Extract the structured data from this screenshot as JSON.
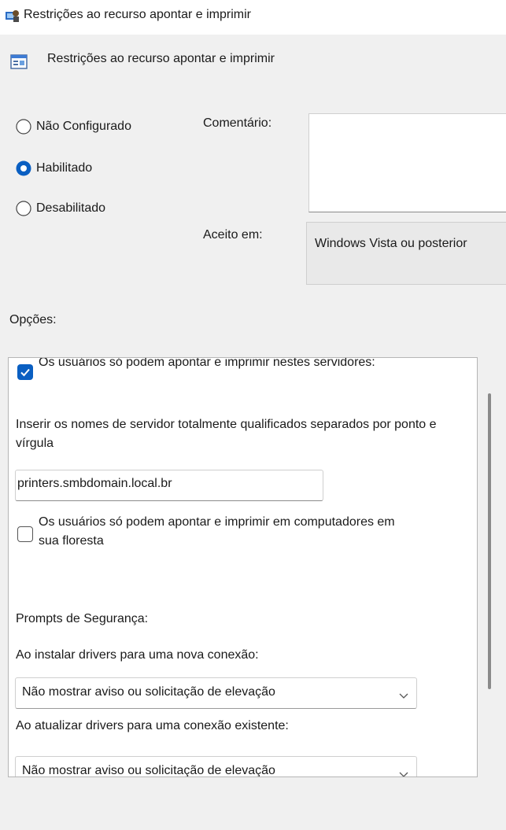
{
  "window": {
    "title": "Restrições ao recurso apontar e imprimir",
    "title_icon": "policy-window-icon"
  },
  "header": {
    "title": "Restrições ao recurso apontar e imprimir",
    "icon": "policy-setting-icon"
  },
  "state": {
    "options": [
      {
        "label": "Não Configurado",
        "selected": false
      },
      {
        "label": "Habilitado",
        "selected": true
      },
      {
        "label": "Desabilitado",
        "selected": false
      }
    ]
  },
  "comment": {
    "label": "Comentário:",
    "value": ""
  },
  "supported": {
    "label": "Aceito em:",
    "value": "Windows Vista ou posterior"
  },
  "options_section": {
    "label": "Opções:",
    "restrict_servers": {
      "label": "Os usuários só podem apontar e imprimir nestes servidores:",
      "checked": true
    },
    "servers_hint": "Inserir os nomes de servidor totalmente qualificados separados por ponto e vírgula",
    "servers_value": "printers.smbdomain.local.br",
    "restrict_forest": {
      "label": "Os usuários só podem apontar e imprimir em computadores em sua floresta",
      "checked": false
    },
    "security_prompts_label": "Prompts de Segurança:",
    "new_connection_label": "Ao instalar drivers para uma nova conexão:",
    "new_connection_value": "Não mostrar aviso ou solicitação de elevação",
    "existing_connection_label": "Ao atualizar drivers para uma conexão existente:",
    "existing_connection_value": "Não mostrar aviso ou solicitação de elevação"
  },
  "colors": {
    "accent": "#0a5fc2",
    "background": "#f0f0f0"
  }
}
